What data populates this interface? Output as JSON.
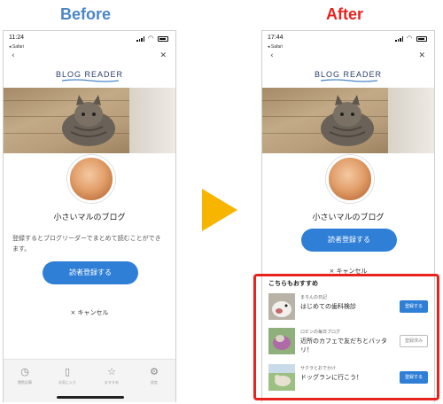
{
  "labels": {
    "before": "Before",
    "after": "After"
  },
  "phone": {
    "time": "11:24",
    "time_after": "17:44",
    "safari": "◂ Safari",
    "back": "‹",
    "close": "✕",
    "logo": "BLOG READER",
    "blog_name": "小さいマルのブログ",
    "description": "登録するとブログリーダーでまとめて読むことができます。",
    "subscribe": "読者登録する",
    "cancel": "× キャンセル"
  },
  "tabs": [
    {
      "icon": "clock-icon",
      "label": "閲覧記事"
    },
    {
      "icon": "bookmark-icon",
      "label": "お気に入り"
    },
    {
      "icon": "star-icon",
      "label": "おすすめ"
    },
    {
      "icon": "gear-icon",
      "label": "設定"
    }
  ],
  "recommend": {
    "title": "こちらもおすすめ",
    "items": [
      {
        "author": "まろんの日記",
        "title": "はじめての歯科検診",
        "button": "登録する",
        "state": "primary"
      },
      {
        "author": "ロビンの毎日ブログ",
        "title": "近所のカフェで友だちとバッタリ！",
        "button": "登録済み",
        "state": "done"
      },
      {
        "author": "サクラとおでかけ",
        "title": "ドッグランに行こう！",
        "button": "登録する",
        "state": "primary"
      }
    ]
  },
  "colors": {
    "accent": "#2f7fd6",
    "highlight": "#e8231e",
    "arrow": "#f7b500",
    "before_label": "#4a86c8"
  }
}
